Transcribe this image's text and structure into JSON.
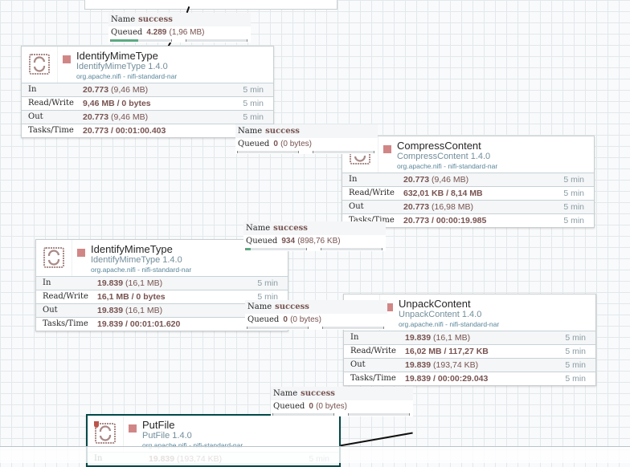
{
  "processors": [
    {
      "name": "IdentifyMimeType",
      "type": "IdentifyMimeType 1.4.0",
      "bundle": "org.apache.nifi - nifi-standard-nar",
      "state": "stopped",
      "stats": [
        {
          "label": "In",
          "value": "20.773",
          "detail": "(9,46 MB)",
          "time": "5 min"
        },
        {
          "label": "Read/Write",
          "value": "9,46 MB / 0 bytes",
          "detail": "",
          "time": "5 min"
        },
        {
          "label": "Out",
          "value": "20.773",
          "detail": "(9,46 MB)",
          "time": "5 min"
        },
        {
          "label": "Tasks/Time",
          "value": "20.773 / 00:01:00.403",
          "detail": "",
          "time": ""
        }
      ]
    },
    {
      "name": "CompressContent",
      "type": "CompressContent 1.4.0",
      "bundle": "org.apache.nifi - nifi-standard-nar",
      "state": "stopped",
      "stats": [
        {
          "label": "In",
          "value": "20.773",
          "detail": "(9,46 MB)",
          "time": "5 min"
        },
        {
          "label": "Read/Write",
          "value": "632,01 KB / 8,14 MB",
          "detail": "",
          "time": "5 min"
        },
        {
          "label": "Out",
          "value": "20.773",
          "detail": "(16,98 MB)",
          "time": "5 min"
        },
        {
          "label": "Tasks/Time",
          "value": "20.773 / 00:00:19.985",
          "detail": "",
          "time": "5 min"
        }
      ]
    },
    {
      "name": "IdentifyMimeType",
      "type": "IdentifyMimeType 1.4.0",
      "bundle": "org.apache.nifi - nifi-standard-nar",
      "state": "stopped",
      "stats": [
        {
          "label": "In",
          "value": "19.839",
          "detail": "(16,1 MB)",
          "time": "5 min"
        },
        {
          "label": "Read/Write",
          "value": "16,1 MB / 0 bytes",
          "detail": "",
          "time": "5 min"
        },
        {
          "label": "Out",
          "value": "19.839",
          "detail": "(16,1 MB)",
          "time": "5 min"
        },
        {
          "label": "Tasks/Time",
          "value": "19.839 / 00:01:01.620",
          "detail": "",
          "time": ""
        }
      ]
    },
    {
      "name": "UnpackContent",
      "type": "UnpackContent 1.4.0",
      "bundle": "org.apache.nifi - nifi-standard-nar",
      "state": "stopped",
      "stats": [
        {
          "label": "In",
          "value": "19.839",
          "detail": "(16,1 MB)",
          "time": "5 min"
        },
        {
          "label": "Read/Write",
          "value": "16,02 MB / 117,27 KB",
          "detail": "",
          "time": "5 min"
        },
        {
          "label": "Out",
          "value": "19.839",
          "detail": "(193,74 KB)",
          "time": "5 min"
        },
        {
          "label": "Tasks/Time",
          "value": "19.839 / 00:00:29.043",
          "detail": "",
          "time": "5 min"
        }
      ]
    },
    {
      "name": "PutFile",
      "type": "PutFile 1.4.0",
      "bundle": "org.apache.nifi - nifi-standard-nar",
      "state": "stopped",
      "stats": [
        {
          "label": "In",
          "value": "19.839",
          "detail": "(193,74 KB)",
          "time": "5 min"
        }
      ]
    }
  ],
  "connections": [
    {
      "name_label": "Name",
      "name": "success",
      "queued_label": "Queued",
      "count": "4.289",
      "size": "(1,96 MB)",
      "fill": 0.45
    },
    {
      "name_label": "Name",
      "name": "success",
      "queued_label": "Queued",
      "count": "0",
      "size": "(0 bytes)",
      "fill": 0
    },
    {
      "name_label": "Name",
      "name": "success",
      "queued_label": "Queued",
      "count": "934",
      "size": "(898,76 KB)",
      "fill": 0.08
    },
    {
      "name_label": "Name",
      "name": "success",
      "queued_label": "Queued",
      "count": "0",
      "size": "(0 bytes)",
      "fill": 0
    },
    {
      "name_label": "Name",
      "name": "success",
      "queued_label": "Queued",
      "count": "0",
      "size": "(0 bytes)",
      "fill": 0
    }
  ],
  "colors": {
    "stopped": "#d18686",
    "queue_fill": "#5baa82",
    "selected_border": "#004849"
  }
}
